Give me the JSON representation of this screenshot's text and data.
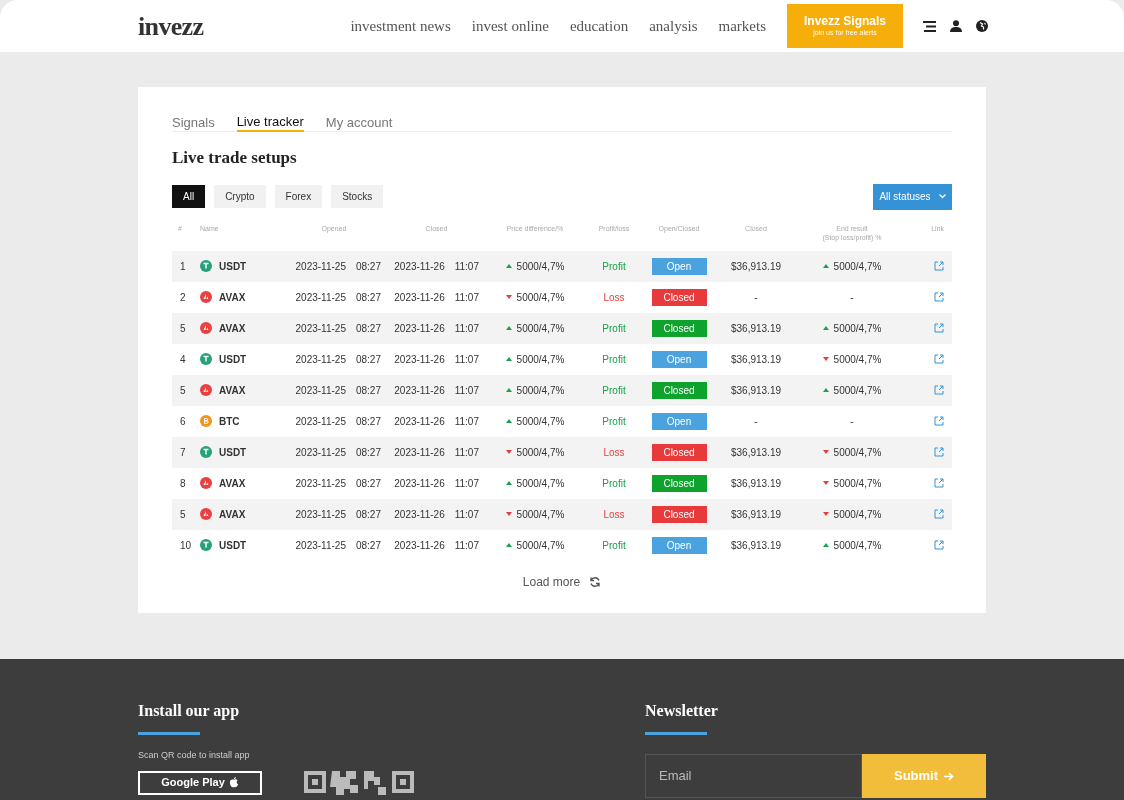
{
  "header": {
    "logo": "invezz",
    "nav": [
      "investment news",
      "invest online",
      "education",
      "analysis",
      "markets"
    ],
    "cta": {
      "title": "Invezz Signals",
      "subtitle": "join us for free alerts"
    }
  },
  "tabs": [
    {
      "label": "Signals",
      "selected": false
    },
    {
      "label": "Live tracker",
      "selected": true
    },
    {
      "label": "My account",
      "selected": false
    }
  ],
  "title": "Live trade setups",
  "filters": [
    {
      "label": "All",
      "selected": true
    },
    {
      "label": "Crypto",
      "selected": false
    },
    {
      "label": "Forex",
      "selected": false
    },
    {
      "label": "Stocks",
      "selected": false
    }
  ],
  "status_dropdown": "All statuses",
  "columns": [
    "#",
    "Name",
    "Opened",
    "Closed",
    "Price difference/%",
    "Profit/loss",
    "Open/Closed",
    "Closed",
    "End result\n(Stop loss/profit) %",
    "Link"
  ],
  "rows": [
    {
      "num": "1",
      "asset": {
        "kind": "usdt",
        "name": "USDT"
      },
      "opened_date": "2023-11-25",
      "opened_time": "08:27",
      "closed_date": "2023-11-26",
      "closed_time": "11:07",
      "price": {
        "kind": "up",
        "text": "5000/4,7%"
      },
      "result": {
        "kind": "profit",
        "text": "Profit"
      },
      "status": {
        "color": "#4aa3df",
        "text": "Open"
      },
      "closed_value": "$36,913.19",
      "end": {
        "kind": "up",
        "text": "5000/4,7%"
      }
    },
    {
      "num": "2",
      "asset": {
        "kind": "avax",
        "name": "AVAX"
      },
      "opened_date": "2023-11-25",
      "opened_time": "08:27",
      "closed_date": "2023-11-26",
      "closed_time": "11:07",
      "price": {
        "kind": "down",
        "text": "5000/4,7%"
      },
      "result": {
        "kind": "loss",
        "text": "Loss"
      },
      "status": {
        "color": "#e83a3a",
        "text": "Closed"
      },
      "closed_value": "-",
      "end": {
        "kind": "none",
        "text": "-"
      }
    },
    {
      "num": "5",
      "asset": {
        "kind": "avax",
        "name": "AVAX"
      },
      "opened_date": "2023-11-25",
      "opened_time": "08:27",
      "closed_date": "2023-11-26",
      "closed_time": "11:07",
      "price": {
        "kind": "up",
        "text": "5000/4,7%"
      },
      "result": {
        "kind": "profit",
        "text": "Profit"
      },
      "status": {
        "color": "#0ea32c",
        "text": "Closed"
      },
      "closed_value": "$36,913.19",
      "end": {
        "kind": "up",
        "text": "5000/4,7%"
      }
    },
    {
      "num": "4",
      "asset": {
        "kind": "usdt",
        "name": "USDT"
      },
      "opened_date": "2023-11-25",
      "opened_time": "08:27",
      "closed_date": "2023-11-26",
      "closed_time": "11:07",
      "price": {
        "kind": "up",
        "text": "5000/4,7%"
      },
      "result": {
        "kind": "profit",
        "text": "Profit"
      },
      "status": {
        "color": "#4aa3df",
        "text": "Open"
      },
      "closed_value": "$36,913.19",
      "end": {
        "kind": "down",
        "text": "5000/4,7%"
      }
    },
    {
      "num": "5",
      "asset": {
        "kind": "avax",
        "name": "AVAX"
      },
      "opened_date": "2023-11-25",
      "opened_time": "08:27",
      "closed_date": "2023-11-26",
      "closed_time": "11:07",
      "price": {
        "kind": "up",
        "text": "5000/4,7%"
      },
      "result": {
        "kind": "profit",
        "text": "Profit"
      },
      "status": {
        "color": "#0ea32c",
        "text": "Closed"
      },
      "closed_value": "$36,913.19",
      "end": {
        "kind": "up",
        "text": "5000/4,7%"
      }
    },
    {
      "num": "6",
      "asset": {
        "kind": "btc",
        "name": "BTC"
      },
      "opened_date": "2023-11-25",
      "opened_time": "08:27",
      "closed_date": "2023-11-26",
      "closed_time": "11:07",
      "price": {
        "kind": "up",
        "text": "5000/4,7%"
      },
      "result": {
        "kind": "profit",
        "text": "Profit"
      },
      "status": {
        "color": "#4aa3df",
        "text": "Open"
      },
      "closed_value": "-",
      "end": {
        "kind": "none",
        "text": "-"
      }
    },
    {
      "num": "7",
      "asset": {
        "kind": "usdt",
        "name": "USDT"
      },
      "opened_date": "2023-11-25",
      "opened_time": "08:27",
      "closed_date": "2023-11-26",
      "closed_time": "11:07",
      "price": {
        "kind": "down",
        "text": "5000/4,7%"
      },
      "result": {
        "kind": "loss",
        "text": "Loss"
      },
      "status": {
        "color": "#e83a3a",
        "text": "Closed"
      },
      "closed_value": "$36,913.19",
      "end": {
        "kind": "down",
        "text": "5000/4,7%"
      }
    },
    {
      "num": "8",
      "asset": {
        "kind": "avax",
        "name": "AVAX"
      },
      "opened_date": "2023-11-25",
      "opened_time": "08:27",
      "closed_date": "2023-11-26",
      "closed_time": "11:07",
      "price": {
        "kind": "up",
        "text": "5000/4,7%"
      },
      "result": {
        "kind": "profit",
        "text": "Profit"
      },
      "status": {
        "color": "#0ea32c",
        "text": "Closed"
      },
      "closed_value": "$36,913.19",
      "end": {
        "kind": "down",
        "text": "5000/4,7%"
      }
    },
    {
      "num": "5",
      "asset": {
        "kind": "avax",
        "name": "AVAX"
      },
      "opened_date": "2023-11-25",
      "opened_time": "08:27",
      "closed_date": "2023-11-26",
      "closed_time": "11:07",
      "price": {
        "kind": "down",
        "text": "5000/4,7%"
      },
      "result": {
        "kind": "loss",
        "text": "Loss"
      },
      "status": {
        "color": "#e83a3a",
        "text": "Closed"
      },
      "closed_value": "$36,913.19",
      "end": {
        "kind": "down",
        "text": "5000/4,7%"
      }
    },
    {
      "num": "10",
      "asset": {
        "kind": "usdt",
        "name": "USDT"
      },
      "opened_date": "2023-11-25",
      "opened_time": "08:27",
      "closed_date": "2023-11-26",
      "closed_time": "11:07",
      "price": {
        "kind": "up",
        "text": "5000/4,7%"
      },
      "result": {
        "kind": "profit",
        "text": "Profit"
      },
      "status": {
        "color": "#4aa3df",
        "text": "Open"
      },
      "closed_value": "$36,913.19",
      "end": {
        "kind": "up",
        "text": "5000/4,7%"
      }
    }
  ],
  "load_more": "Load more",
  "footer": {
    "app_title": "Install our app",
    "app_hint": "Scan QR code to install app",
    "store_button": "Google Play",
    "newsletter_title": "Newsletter",
    "email_placeholder": "Email",
    "submit": "Submit"
  }
}
